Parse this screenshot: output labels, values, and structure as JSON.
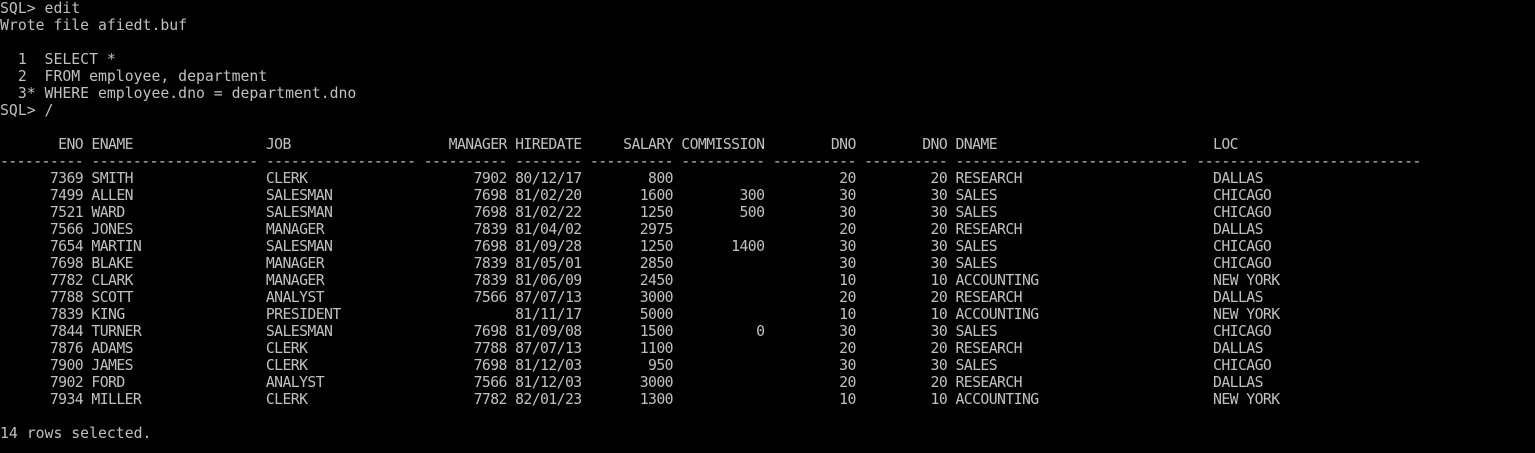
{
  "terminal": {
    "prompt_edit": "SQL> edit",
    "wrote_file": "Wrote file afiedt.buf",
    "buffer_lines": [
      "  1  SELECT *",
      "  2  FROM employee, department",
      "  3* WHERE employee.dno = department.dno"
    ],
    "prompt_run": "SQL> /",
    "header": "       ENO ENAME                JOB                   MANAGER HIREDATE     SALARY COMMISSION        DNO        DNO DNAME                          LOC",
    "separator": "---------- -------------------- ------------------ ---------- -------- ---------- ---------- ---------- ---------- ---------------------------- ---------------------------",
    "rows": [
      "      7369 SMITH                CLERK                    7902 80/12/17        800                    20         20 RESEARCH                       DALLAS",
      "      7499 ALLEN                SALESMAN                 7698 81/02/20       1600        300         30         30 SALES                          CHICAGO",
      "      7521 WARD                 SALESMAN                 7698 81/02/22       1250        500         30         30 SALES                          CHICAGO",
      "      7566 JONES                MANAGER                  7839 81/04/02       2975                    20         20 RESEARCH                       DALLAS",
      "      7654 MARTIN               SALESMAN                 7698 81/09/28       1250       1400         30         30 SALES                          CHICAGO",
      "      7698 BLAKE                MANAGER                  7839 81/05/01       2850                    30         30 SALES                          CHICAGO",
      "      7782 CLARK                MANAGER                  7839 81/06/09       2450                    10         10 ACCOUNTING                     NEW YORK",
      "      7788 SCOTT                ANALYST                  7566 87/07/13       3000                    20         20 RESEARCH                       DALLAS",
      "      7839 KING                 PRESIDENT                     81/11/17       5000                    10         10 ACCOUNTING                     NEW YORK",
      "      7844 TURNER               SALESMAN                 7698 81/09/08       1500          0         30         30 SALES                          CHICAGO",
      "      7876 ADAMS                CLERK                    7788 87/07/13       1100                    20         20 RESEARCH                       DALLAS",
      "      7900 JAMES                CLERK                    7698 81/12/03        950                    30         30 SALES                          CHICAGO",
      "      7902 FORD                 ANALYST                  7566 81/12/03       3000                    20         20 RESEARCH                       DALLAS",
      "      7934 MILLER               CLERK                    7782 82/01/23       1300                    10         10 ACCOUNTING                     NEW YORK"
    ],
    "footer": "14 rows selected."
  },
  "colors": {
    "background": "#000000",
    "text": "#c0c0c0"
  }
}
